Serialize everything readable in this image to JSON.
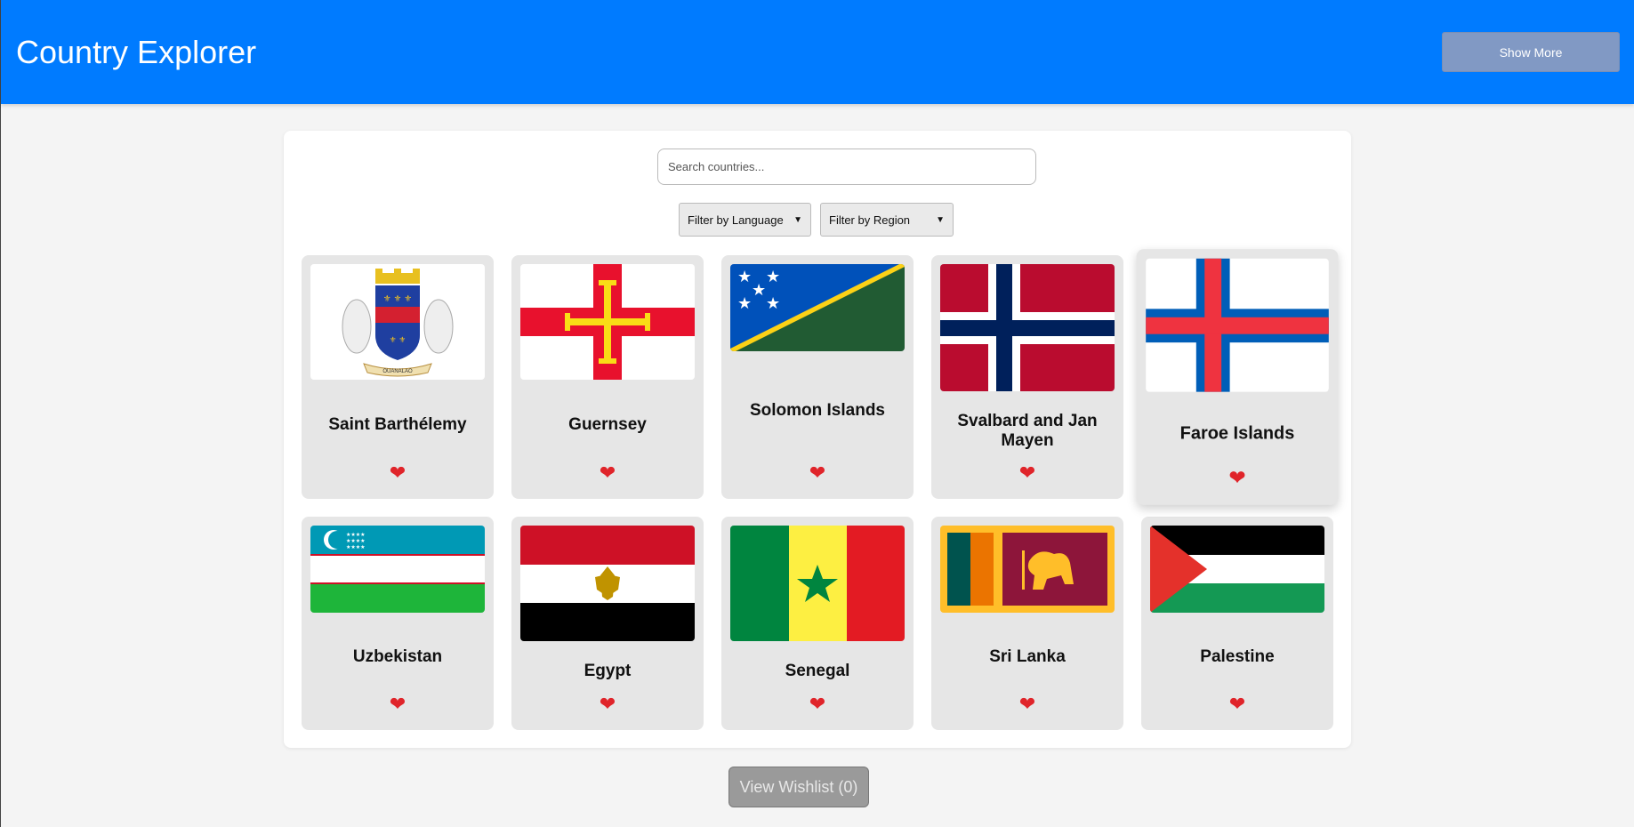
{
  "header": {
    "title": "Country Explorer",
    "show_more_label": "Show More"
  },
  "search": {
    "placeholder": "Search countries..."
  },
  "filters": {
    "language_label": "Filter by Language",
    "region_label": "Filter by Region"
  },
  "countries": [
    {
      "name": "Saint Barthélemy"
    },
    {
      "name": "Guernsey"
    },
    {
      "name": "Solomon Islands"
    },
    {
      "name": "Svalbard and Jan Mayen"
    },
    {
      "name": "Faroe Islands"
    },
    {
      "name": "Uzbekistan"
    },
    {
      "name": "Egypt"
    },
    {
      "name": "Senegal"
    },
    {
      "name": "Sri Lanka"
    },
    {
      "name": "Palestine"
    }
  ],
  "wishlist": {
    "label": "View Wishlist (0)"
  },
  "colors": {
    "header": "#007bff",
    "heart": "#e0242a"
  }
}
